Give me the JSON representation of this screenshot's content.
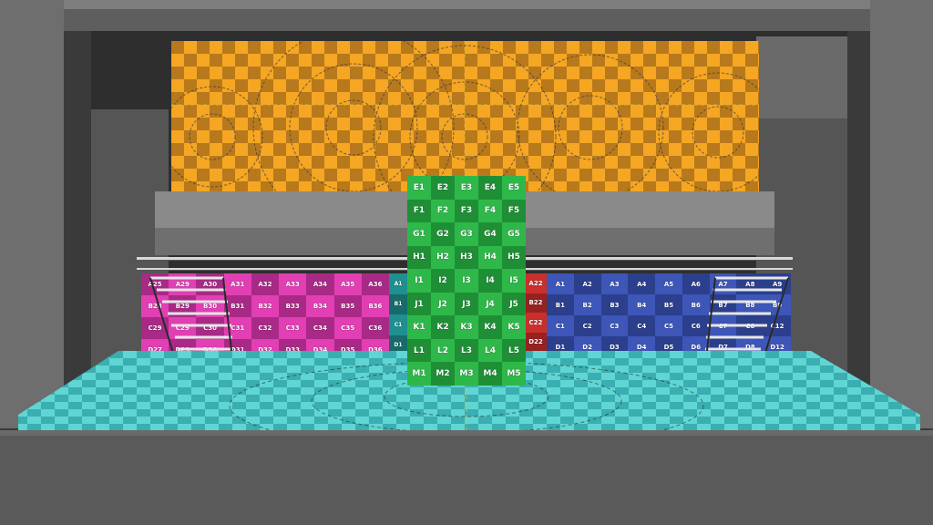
{
  "colors": {
    "backdrop_light": "#f5a623",
    "backdrop_dark": "#b8791c",
    "green_light": "#2fb84a",
    "green_dark": "#1f8f36",
    "pink_light": "#e13fb3",
    "pink_dark": "#a82a86",
    "blue_light": "#3d56b8",
    "blue_dark": "#2b3f8c",
    "red_light": "#c9302c",
    "red_dark": "#952221",
    "teal_light": "#1f8f8f",
    "teal_dark": "#176b6b",
    "floor_light": "#5fd6d3",
    "floor_dark": "#3aaeb0",
    "structure": "#7a7a7a",
    "structure_dark": "#4a4a4a"
  },
  "green_panel": {
    "rows": [
      "E",
      "F",
      "G",
      "H",
      "I",
      "J",
      "K",
      "L",
      "M"
    ],
    "cols": [
      "1",
      "2",
      "3",
      "4",
      "5"
    ]
  },
  "pink_panel": {
    "rows": [
      "A",
      "B",
      "C",
      "D"
    ],
    "cols": [
      "29",
      "30",
      "31",
      "32",
      "33",
      "34",
      "35",
      "36"
    ],
    "partial_left": [
      "A25",
      "B28",
      "C29",
      "D27"
    ]
  },
  "blue_panel": {
    "rows": [
      "A",
      "B",
      "C",
      "D"
    ],
    "cols": [
      "1",
      "2",
      "3",
      "4",
      "5",
      "6",
      "7",
      "8"
    ],
    "partial_right": [
      "A9",
      "B9",
      "C12",
      "D12"
    ]
  },
  "red_panel": {
    "labels": [
      "A22",
      "B22",
      "C22",
      "D22"
    ]
  },
  "teal_panel": {
    "labels": [
      "A1",
      "B1",
      "C1",
      "D1"
    ]
  }
}
